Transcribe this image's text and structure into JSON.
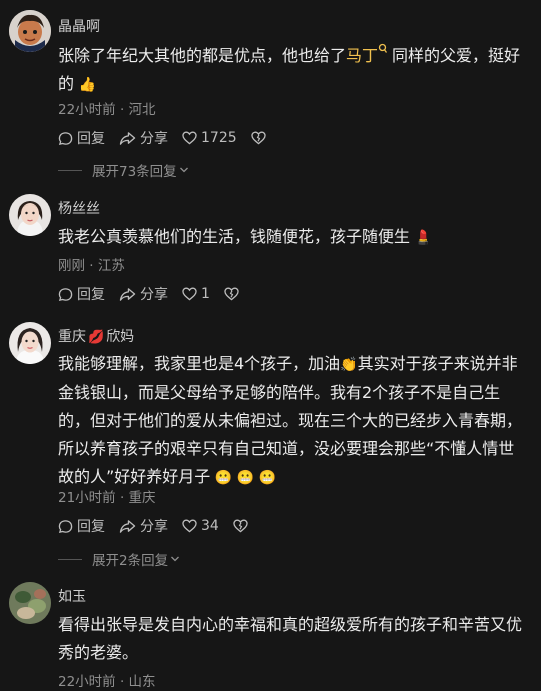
{
  "comments": [
    {
      "name": "晶晶啊",
      "text_before": "张除了年纪大其他的都是优点，他也给了",
      "link": "马丁",
      "text_after": "同样的父爱，挺好的",
      "meta": "22小时前 · 河北",
      "reply": "回复",
      "share": "分享",
      "likes": "1725",
      "expand": "展开73条回复"
    },
    {
      "name": "杨丝丝",
      "text": "我老公真羡慕他们的生活，钱随便花，孩子随便生",
      "meta": "刚刚 · 江苏",
      "reply": "回复",
      "share": "分享",
      "likes": "1"
    },
    {
      "name_a": "重庆",
      "name_b": "欣妈",
      "text_before": "我能够理解，我家里也是4个孩子，加油",
      "text_after": "其实对于孩子来说并非金钱银山，而是父母给予足够的陪伴。我有2个孩子不是自己生的，但对于他们的爱从未偏袒过。现在三个大的已经步入青春期，所以养育孩子的艰辛只有自己知道，没必要理会那些“不懂人情世故的人”好好养好月子",
      "meta": "21小时前 · 重庆",
      "reply": "回复",
      "share": "分享",
      "likes": "34",
      "expand": "展开2条回复"
    },
    {
      "name": "如玉",
      "text": "看得出张导是发自内心的幸福和真的超级爱所有的孩子和辛苦又优秀的老婆。",
      "meta": "22小时前 · 山东"
    }
  ],
  "icons": {
    "reply": "reply-bubble-icon",
    "share": "share-arrow-icon",
    "like": "heart-icon",
    "dislike": "broken-heart-icon",
    "expand": "chevron-down-icon",
    "search": "search-icon"
  },
  "colors": {
    "background": "#161616",
    "link": "#f0c04f",
    "meta": "#8f8f8f"
  }
}
